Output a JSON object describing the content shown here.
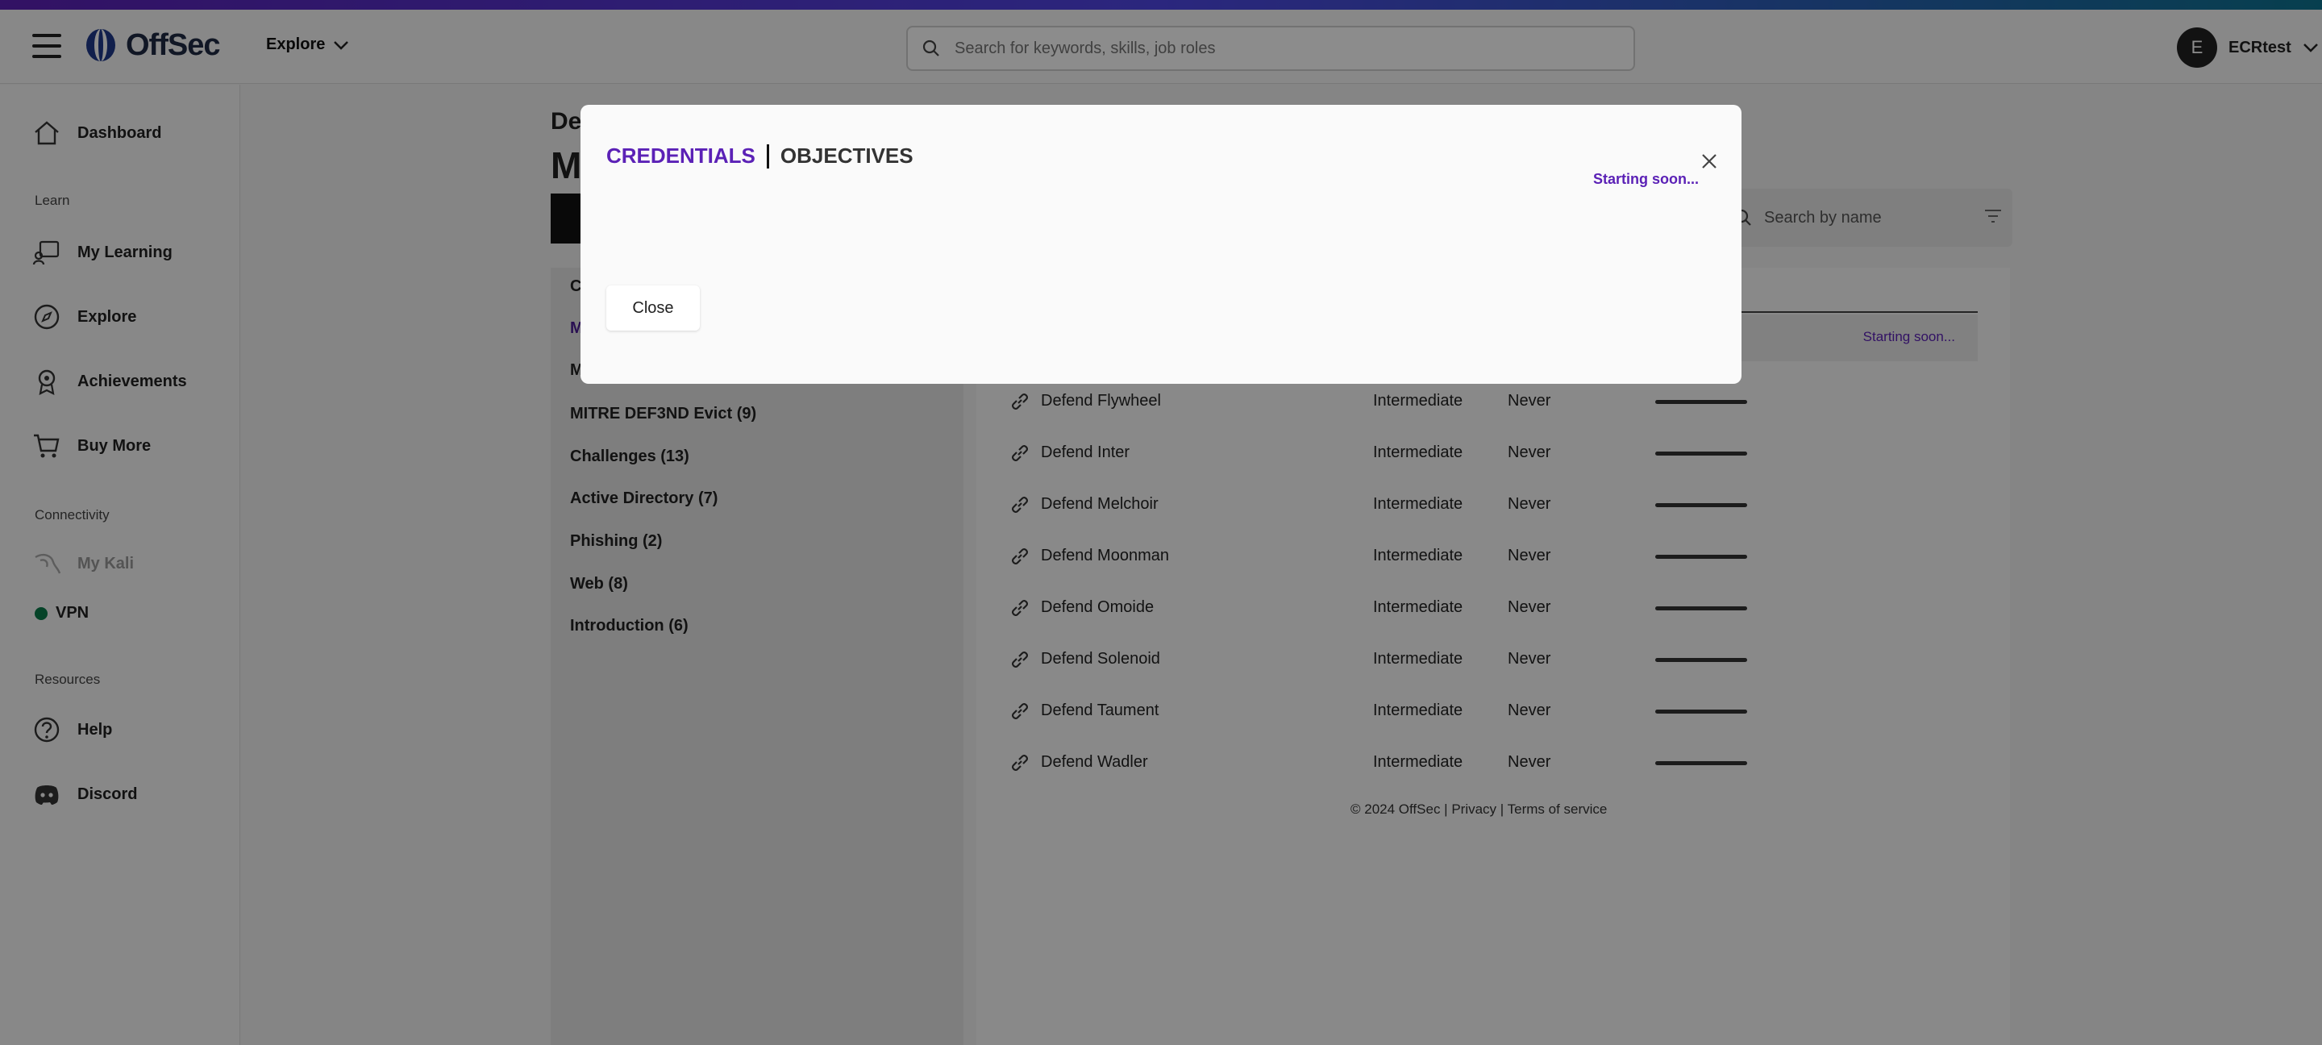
{
  "header": {
    "brand": "OffSec",
    "explore_label": "Explore",
    "search_placeholder": "Search for keywords, skills, job roles",
    "avatar_initial": "E",
    "username": "ECRtest"
  },
  "sidebar": {
    "dashboard": "Dashboard",
    "section_learn": "Learn",
    "my_learning": "My Learning",
    "explore": "Explore",
    "achievements": "Achievements",
    "buy_more": "Buy More",
    "section_connectivity": "Connectivity",
    "my_kali": "My Kali",
    "vpn": "VPN",
    "section_resources": "Resources",
    "help": "Help",
    "discord": "Discord"
  },
  "page": {
    "title_a": "De",
    "title_b": "M",
    "search_name_placeholder": "Search by name"
  },
  "categories": {
    "c1": "C",
    "c2": "M",
    "c3": "M",
    "evict": "MITRE DEF3ND Evict (9)",
    "challenges": "Challenges (13)",
    "active_directory": "Active Directory (7)",
    "phishing": "Phishing (2)",
    "web": "Web (8)",
    "introduction": "Introduction (6)"
  },
  "list": {
    "starting_text": "Starting soon...",
    "rows": [
      {
        "name": "Defend Flywheel",
        "level": "Intermediate",
        "last": "Never"
      },
      {
        "name": "Defend Inter",
        "level": "Intermediate",
        "last": "Never"
      },
      {
        "name": "Defend Melchoir",
        "level": "Intermediate",
        "last": "Never"
      },
      {
        "name": "Defend Moonman",
        "level": "Intermediate",
        "last": "Never"
      },
      {
        "name": "Defend Omoide",
        "level": "Intermediate",
        "last": "Never"
      },
      {
        "name": "Defend Solenoid",
        "level": "Intermediate",
        "last": "Never"
      },
      {
        "name": "Defend Taument",
        "level": "Intermediate",
        "last": "Never"
      },
      {
        "name": "Defend Wadler",
        "level": "Intermediate",
        "last": "Never"
      }
    ],
    "footer_copyright": "© 2024  OffSec",
    "footer_privacy": "Privacy",
    "footer_terms": "Terms of service"
  },
  "modal": {
    "tab_credentials": "CREDENTIALS",
    "tab_objectives": "OBJECTIVES",
    "status": "Starting soon...",
    "close_button": "Close"
  },
  "colors": {
    "accent_purple": "#5b21b6",
    "vpn_green": "#0a7a4a"
  }
}
